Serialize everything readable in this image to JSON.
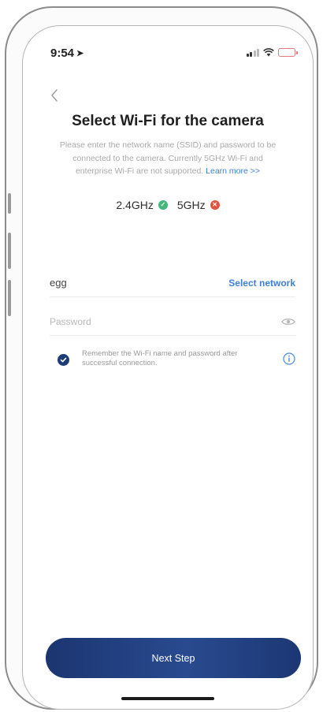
{
  "status_bar": {
    "time": "9:54",
    "location_icon": "location-arrow-icon",
    "signal_icon": "cellular-signal-icon",
    "wifi_icon": "wifi-icon",
    "battery_icon": "battery-low-icon"
  },
  "header": {
    "back_icon": "chevron-left-icon",
    "title": "Select Wi-Fi for the camera",
    "description": "Please enter the network name (SSID) and password to be connected to the camera. Currently 5GHz Wi-Fi and enterprise Wi-Fi are not supported.",
    "learn_more": "Learn more >>"
  },
  "bands": [
    {
      "label": "2.4GHz",
      "supported": true,
      "icon": "check-circle-icon",
      "color": "#3fb87a"
    },
    {
      "label": "5GHz",
      "supported": false,
      "icon": "cross-circle-icon",
      "color": "#e2533f"
    }
  ],
  "form": {
    "ssid_value": "egg",
    "select_network_label": "Select network",
    "password_value": "",
    "password_placeholder": "Password",
    "remember_checked": true,
    "remember_text": "Remember the Wi-Fi name and password after successful connection."
  },
  "actions": {
    "next_step_label": "Next Step"
  },
  "colors": {
    "accent": "#3f7fd6",
    "primary_button": "#1e3c78",
    "ok": "#3fb87a",
    "error": "#e2533f"
  }
}
